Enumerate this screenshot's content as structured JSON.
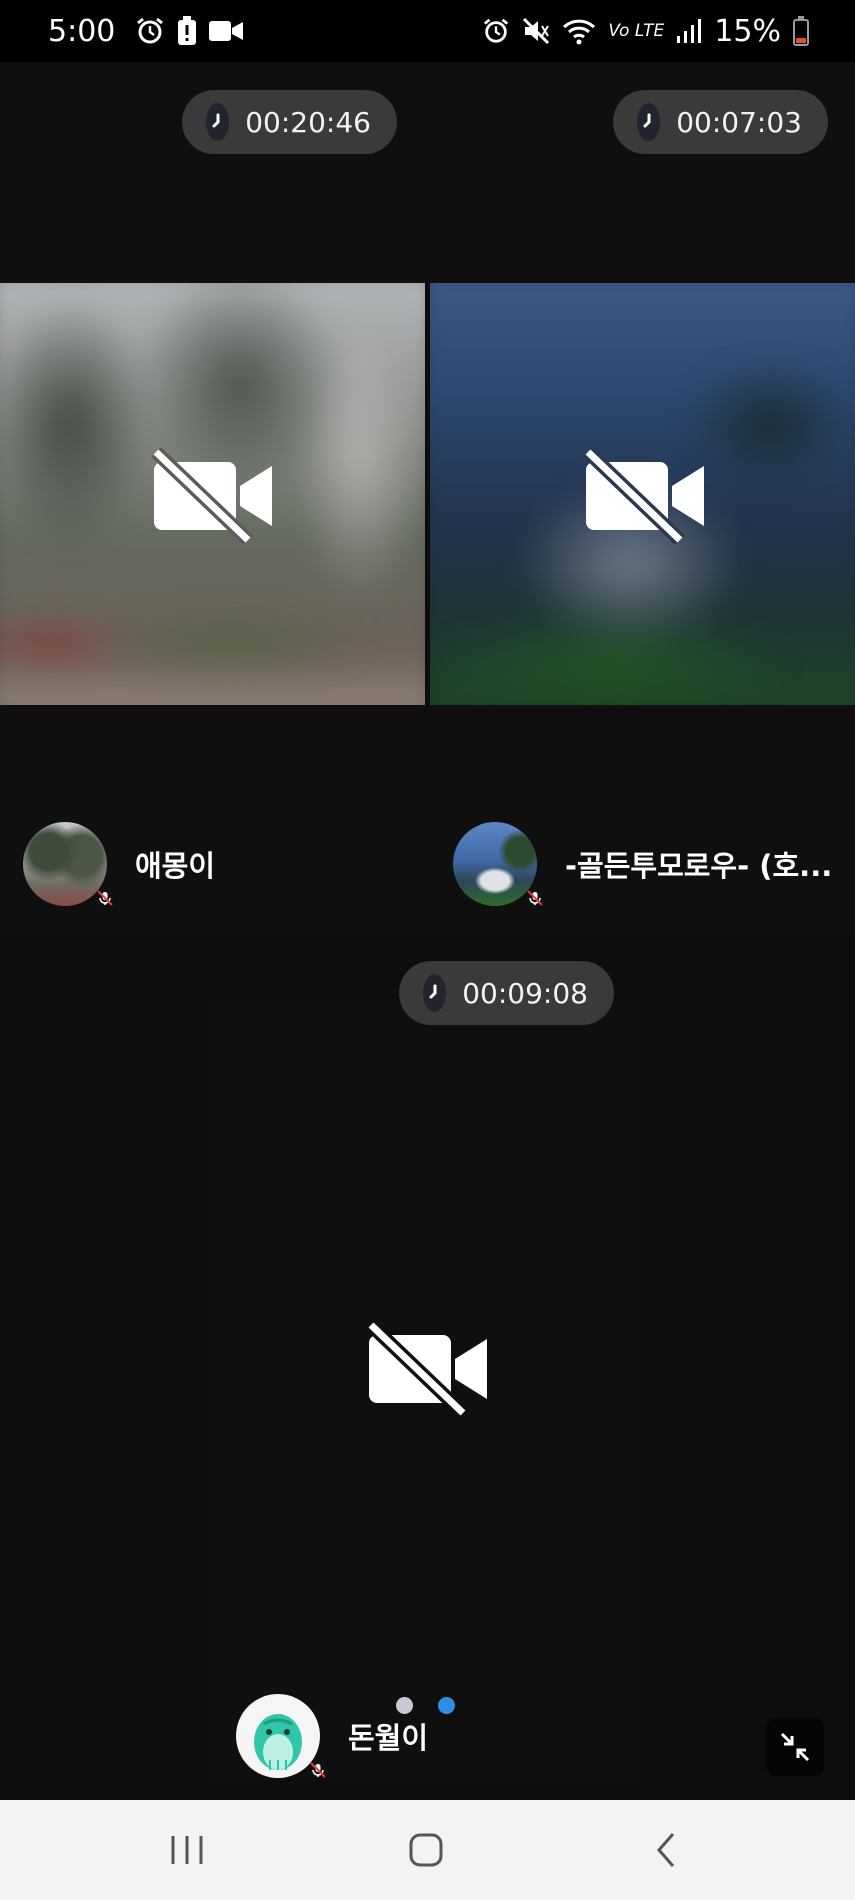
{
  "status_bar": {
    "time": "5:00",
    "battery": "15%",
    "left_icons": [
      "alarm-icon",
      "battery-alert-icon",
      "video-call-icon"
    ],
    "right_icons": [
      "alarm-icon",
      "mute-icon",
      "wifi-icon",
      "volte-icon",
      "signal-icon",
      "battery-icon"
    ],
    "network_label": "Vo LTE"
  },
  "participants": [
    {
      "name": "애몽이",
      "timer": "00:20:46",
      "camera": "off",
      "mic": "muted"
    },
    {
      "name": "-골든투모로우- (호...",
      "timer": "00:07:03",
      "camera": "off",
      "mic": "muted"
    },
    {
      "name": "돈월이",
      "timer": "00:09:08",
      "camera": "off",
      "mic": "muted"
    }
  ],
  "pager": {
    "pages": 2,
    "current": 2
  },
  "colors": {
    "background": "#0d0d0d",
    "timer_pill": "#3a3a3a",
    "active_dot": "#2d8ee8",
    "inactive_dot": "#c9c9d6",
    "nav_bar": "#f3f3f3"
  },
  "controls": {
    "minimize": "minimize-icon",
    "nav": [
      "recent-apps-icon",
      "home-icon",
      "back-icon"
    ]
  }
}
